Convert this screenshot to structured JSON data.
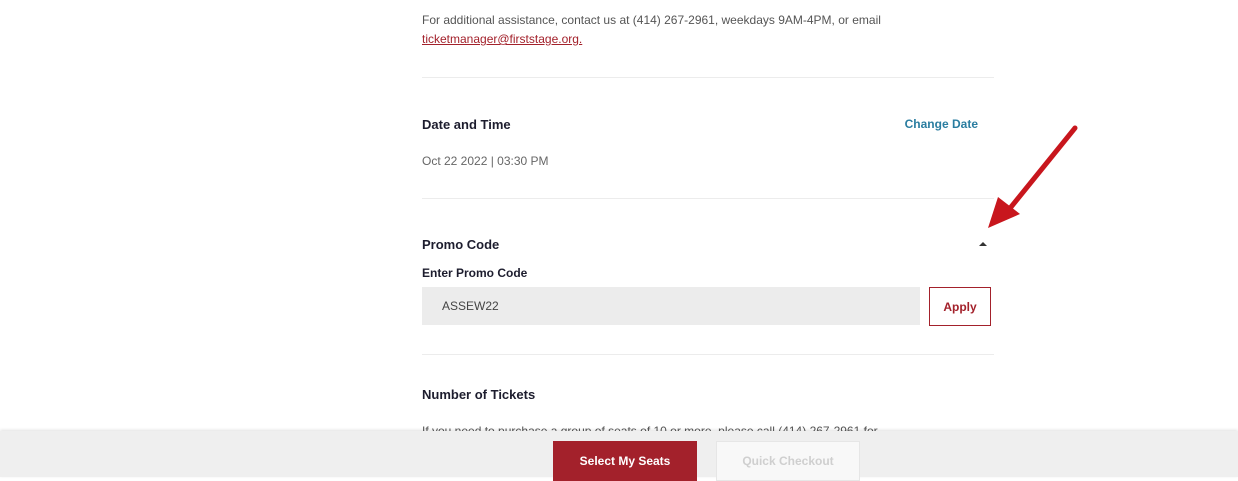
{
  "assistance": {
    "text": "For additional assistance, contact us at (414) 267-2961, weekdays 9AM-4PM, or email",
    "email": "ticketmanager@firststage.org."
  },
  "date_time": {
    "title": "Date and Time",
    "change_label": "Change Date",
    "value": "Oct 22 2022 | 03:30 PM"
  },
  "promo": {
    "title": "Promo Code",
    "input_label": "Enter Promo Code",
    "input_value": "ASSEW22",
    "apply_label": "Apply"
  },
  "tickets": {
    "title": "Number of Tickets",
    "group_text": "If you need to purchase a group of seats of 10 or more, please call (414) 267-2961 for"
  },
  "footer": {
    "select_seats_label": "Select My Seats",
    "quick_checkout_label": "Quick Checkout"
  },
  "colors": {
    "brand_red": "#a3212b",
    "link_blue": "#2a7da0",
    "annotation_arrow": "#c8161d"
  }
}
